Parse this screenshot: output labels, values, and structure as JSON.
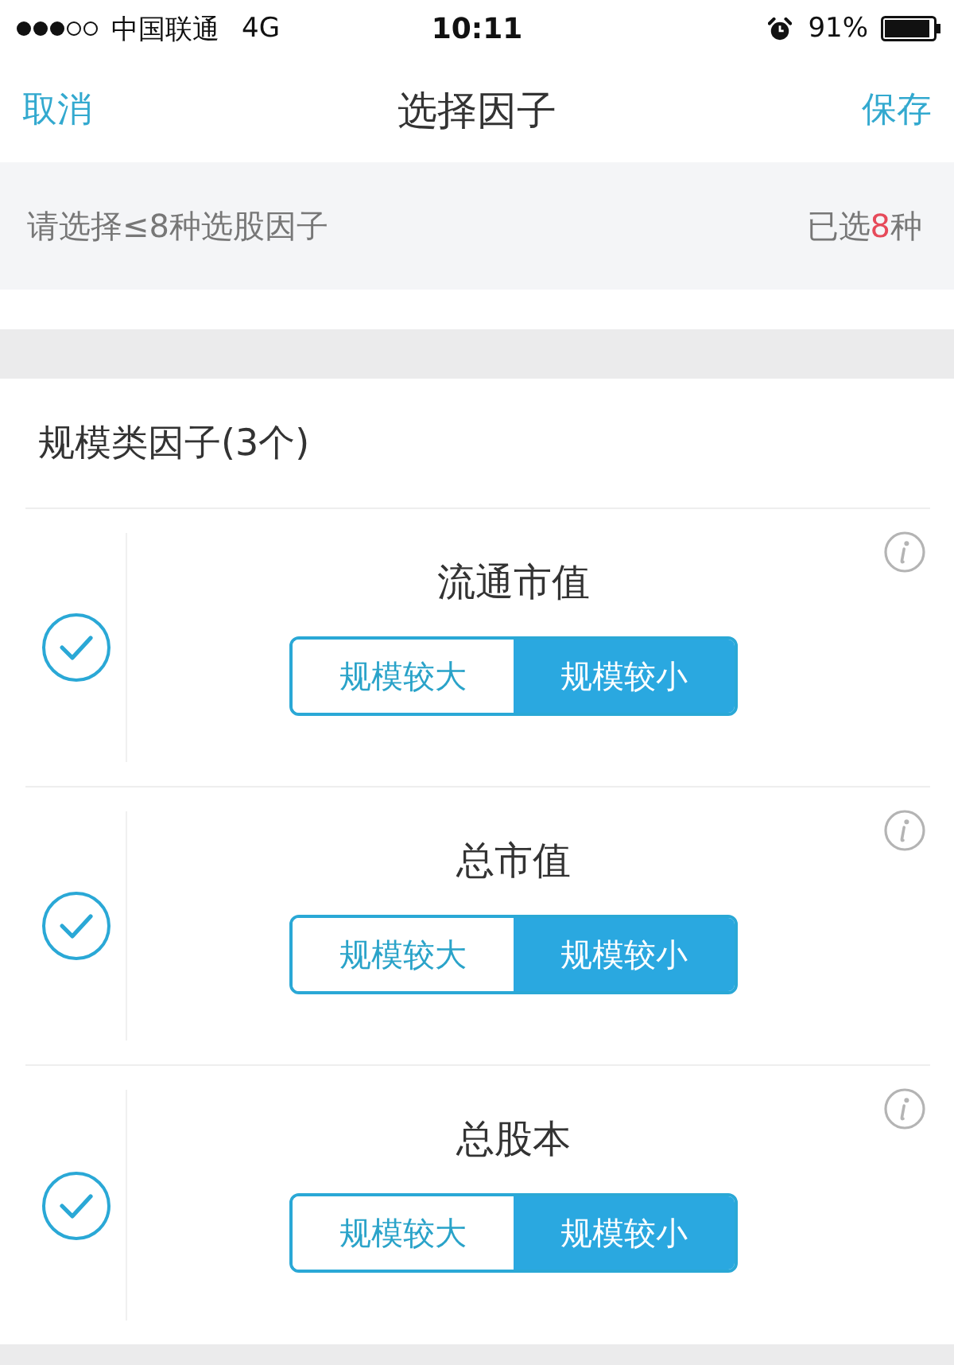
{
  "status_bar": {
    "carrier": "中国联通",
    "network": "4G",
    "time": "10:11",
    "battery_percent": "91%"
  },
  "nav_bar": {
    "cancel": "取消",
    "title": "选择因子",
    "save": "保存"
  },
  "hint_bar": {
    "instruction": "请选择≤8种选股因子",
    "selected_count": {
      "prefix": "已选",
      "count": "8",
      "suffix": "种"
    }
  },
  "section": {
    "title": "规模类因子(3个)",
    "factors": [
      {
        "name": "流通市值",
        "checked": true,
        "options": [
          {
            "label": "规模较大",
            "selected": false
          },
          {
            "label": "规模较小",
            "selected": true
          }
        ]
      },
      {
        "name": "总市值",
        "checked": true,
        "options": [
          {
            "label": "规模较大",
            "selected": false
          },
          {
            "label": "规模较小",
            "selected": true
          }
        ]
      },
      {
        "name": "总股本",
        "checked": true,
        "options": [
          {
            "label": "规模较大",
            "selected": false
          },
          {
            "label": "规模较小",
            "selected": true
          }
        ]
      }
    ]
  }
}
